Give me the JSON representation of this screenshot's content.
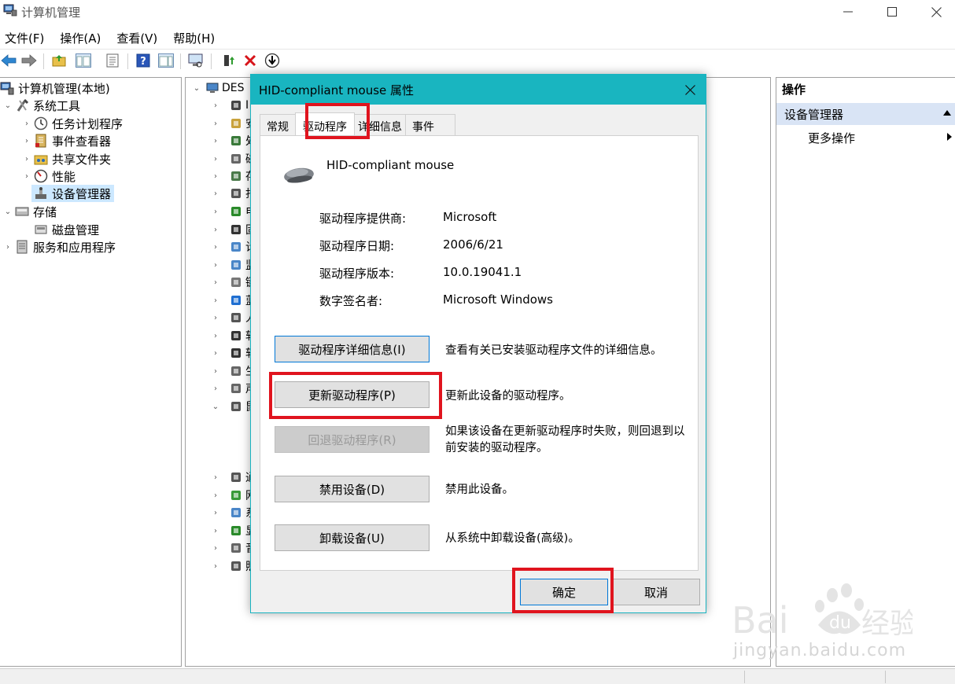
{
  "window": {
    "title": "计算机管理",
    "minimize_glyph": "—",
    "maximize_glyph": "☐",
    "close_glyph": "✕"
  },
  "menu": [
    "文件(F)",
    "操作(A)",
    "查看(V)",
    "帮助(H)"
  ],
  "tree": {
    "root": "计算机管理(本地)",
    "system_tools": "系统工具",
    "task_scheduler": "任务计划程序",
    "event_viewer": "事件查看器",
    "shared_folders": "共享文件夹",
    "performance": "性能",
    "device_manager": "设备管理器",
    "storage": "存储",
    "disk_management": "磁盘管理",
    "services_apps": "服务和应用程序"
  },
  "center": {
    "root_label": "DES",
    "partial_labels": [
      "I",
      "安",
      "处",
      "磁",
      "存",
      "打",
      "电",
      "固",
      "计",
      "监",
      "键",
      "蓝",
      "人",
      "软",
      "软",
      "生",
      "声",
      "鼠",
      "通",
      "网",
      "系",
      "显",
      "音",
      "照"
    ]
  },
  "actions": {
    "header": "操作",
    "section": "设备管理器",
    "more": "更多操作"
  },
  "dialog": {
    "title": "HID-compliant mouse 属性",
    "tabs": [
      "常规",
      "驱动程序",
      "详细信息",
      "事件"
    ],
    "device_name": "HID-compliant mouse",
    "properties": [
      {
        "label": "驱动程序提供商:",
        "value": "Microsoft"
      },
      {
        "label": "驱动程序日期:",
        "value": "2006/6/21"
      },
      {
        "label": "驱动程序版本:",
        "value": "10.0.19041.1"
      },
      {
        "label": "数字签名者:",
        "value": "Microsoft Windows"
      }
    ],
    "buttons": [
      {
        "label": "驱动程序详细信息(I)",
        "desc": "查看有关已安装驱动程序文件的详细信息。"
      },
      {
        "label": "更新驱动程序(P)",
        "desc": "更新此设备的驱动程序。"
      },
      {
        "label": "回退驱动程序(R)",
        "desc": "如果该设备在更新驱动程序时失败，则回退到以前安装的驱动程序。"
      },
      {
        "label": "禁用设备(D)",
        "desc": "禁用此设备。"
      },
      {
        "label": "卸载设备(U)",
        "desc": "从系统中卸载设备(高级)。"
      }
    ],
    "ok": "确定",
    "cancel": "取消"
  },
  "watermark": {
    "brand": "Bai du 经验",
    "url": "jingyan.baidu.com"
  },
  "colors": {
    "dialog_titlebar": "#19b5c0",
    "highlight_red": "#e0141e",
    "selection_blue": "#d9e4f5"
  }
}
